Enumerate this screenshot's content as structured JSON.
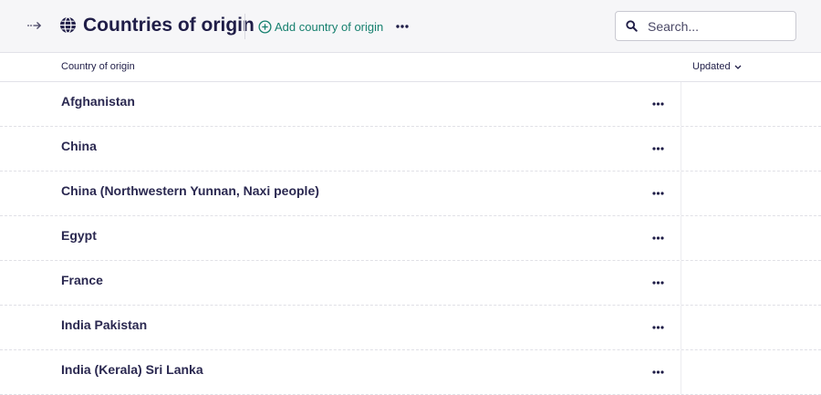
{
  "header": {
    "title": "Countries of origin",
    "add_label": "Add country of origin",
    "search_placeholder": "Search..."
  },
  "columns": {
    "name": "Country of origin",
    "updated": "Updated"
  },
  "rows": [
    {
      "name": "Afghanistan"
    },
    {
      "name": "China"
    },
    {
      "name": "China (Northwestern Yunnan, Naxi people)"
    },
    {
      "name": "Egypt"
    },
    {
      "name": "France"
    },
    {
      "name": "India Pakistan"
    },
    {
      "name": "India (Kerala) Sri Lanka"
    }
  ],
  "icons": {
    "expand": "arrow-right-icon",
    "title": "globe-icon",
    "add": "plus-circle-icon",
    "more": "ellipsis-icon",
    "search": "search-icon",
    "sort": "chevron-down-icon"
  },
  "colors": {
    "title": "#1f1d47",
    "accent": "#17806f",
    "header_bg": "#f6f6f8"
  }
}
